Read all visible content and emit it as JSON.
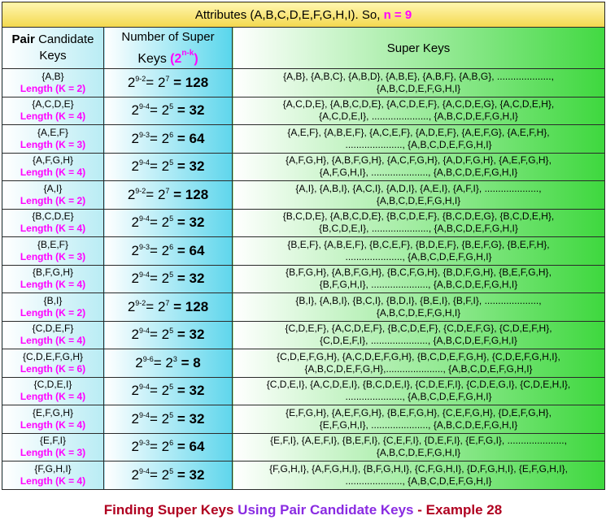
{
  "title": {
    "prefix": "Attributes (A,B,C,D,E,F,G,H,I). So,",
    "n_text": "n = 9"
  },
  "headers": {
    "col1_bold": "Pair",
    "col1_rest": "Candidate Keys",
    "col2_line1": "Number of Super",
    "col2_keys": "Keys",
    "col2_formula_base": "(2",
    "col2_formula_exp": "n-k",
    "col2_formula_close": ")",
    "col3": "Super Keys"
  },
  "rows": [
    {
      "key": "{A,B}",
      "length": "Length (K = 2)",
      "exp1": "9-2",
      "exp2": "7",
      "result": "= 128",
      "supers_line1": "{A,B}, {A,B,C}, {A,B,D}, {A,B,E}, {A,B,F}, {A,B,G}, ....................,",
      "supers_line2": "{A,B,C,D,E,F,G,H,I}"
    },
    {
      "key": "{A,C,D,E}",
      "length": "Length (K = 4)",
      "exp1": "9-4",
      "exp2": "5",
      "result": "= 32",
      "supers_line1": "{A,C,D,E}, {A,B,C,D,E}, {A,C,D,E,F}, {A,C,D,E,G}, {A,C,D,E,H},",
      "supers_line2": "{A,C,D,E,I}, ....................., {A,B,C,D,E,F,G,H,I}"
    },
    {
      "key": "{A,E,F}",
      "length": "Length (K = 3)",
      "exp1": "9-3",
      "exp2": "6",
      "result": "= 64",
      "supers_line1": "{A,E,F}, {A,B,E,F}, {A,C,E,F}, {A,D,E,F}, {A,E,F,G}, {A,E,F,H},",
      "supers_line2": "....................., {A,B,C,D,E,F,G,H,I}"
    },
    {
      "key": "{A,F,G,H}",
      "length": "Length (K = 4)",
      "exp1": "9-4",
      "exp2": "5",
      "result": "= 32",
      "supers_line1": "{A,F,G,H}, {A,B,F,G,H}, {A,C,F,G,H}, {A,D,F,G,H}, {A,E,F,G,H},",
      "supers_line2": "{A,F,G,H,I}, ....................., {A,B,C,D,E,F,G,H,I}"
    },
    {
      "key": "{A,I}",
      "length": "Length (K = 2)",
      "exp1": "9-2",
      "exp2": "7",
      "result": "= 128",
      "supers_line1": "{A,I}, {A,B,I}, {A,C,I}, {A,D,I}, {A,E,I}, {A,F,I}, ....................,",
      "supers_line2": "{A,B,C,D,E,F,G,H,I}"
    },
    {
      "key": "{B,C,D,E}",
      "length": "Length (K = 4)",
      "exp1": "9-4",
      "exp2": "5",
      "result": "= 32",
      "supers_line1": "{B,C,D,E}, {A,B,C,D,E}, {B,C,D,E,F}, {B,C,D,E,G}, {B,C,D,E,H},",
      "supers_line2": "{B,C,D,E,I}, ....................., {A,B,C,D,E,F,G,H,I}"
    },
    {
      "key": "{B,E,F}",
      "length": "Length (K = 3)",
      "exp1": "9-3",
      "exp2": "6",
      "result": "= 64",
      "supers_line1": "{B,E,F}, {A,B,E,F}, {B,C,E,F}, {B,D,E,F}, {B,E,F,G}, {B,E,F,H},",
      "supers_line2": "....................., {A,B,C,D,E,F,G,H,I}"
    },
    {
      "key": "{B,F,G,H}",
      "length": "Length (K = 4)",
      "exp1": "9-4",
      "exp2": "5",
      "result": "= 32",
      "supers_line1": "{B,F,G,H}, {A,B,F,G,H}, {B,C,F,G,H}, {B,D,F,G,H}, {B,E,F,G,H},",
      "supers_line2": "{B,F,G,H,I}, ....................., {A,B,C,D,E,F,G,H,I}"
    },
    {
      "key": "{B,I}",
      "length": "Length (K = 2)",
      "exp1": "9-2",
      "exp2": "7",
      "result": "= 128",
      "supers_line1": "{B,I}, {A,B,I}, {B,C,I}, {B,D,I}, {B,E,I}, {B,F,I}, ....................,",
      "supers_line2": "{A,B,C,D,E,F,G,H,I}"
    },
    {
      "key": "{C,D,E,F}",
      "length": "Length (K = 4)",
      "exp1": "9-4",
      "exp2": "5",
      "result": "= 32",
      "supers_line1": "{C,D,E,F}, {A,C,D,E,F}, {B,C,D,E,F}, {C,D,E,F,G}, {C,D,E,F,H},",
      "supers_line2": "{C,D,E,F,I}, ....................., {A,B,C,D,E,F,G,H,I}"
    },
    {
      "key": "{C,D,E,F,G,H}",
      "length": "Length (K = 6)",
      "exp1": "9-6",
      "exp2": "3",
      "result": "= 8",
      "supers_line1": "{C,D,E,F,G,H}, {A,C,D,E,F,G,H}, {B,C,D,E,F,G,H}, {C,D,E,F,G,H,I},",
      "supers_line2": "{A,B,C,D,E,F,G,H},....................., {A,B,C,D,E,F,G,H,I}"
    },
    {
      "key": "{C,D,E,I}",
      "length": "Length (K = 4)",
      "exp1": "9-4",
      "exp2": "5",
      "result": "= 32",
      "supers_line1": "{C,D,E,I}, {A,C,D,E,I}, {B,C,D,E,I}, {C,D,E,F,I}, {C,D,E,G,I}, {C,D,E,H,I},",
      "supers_line2": "....................., {A,B,C,D,E,F,G,H,I}"
    },
    {
      "key": "{E,F,G,H}",
      "length": "Length (K = 4)",
      "exp1": "9-4",
      "exp2": "5",
      "result": "= 32",
      "supers_line1": "{E,F,G,H}, {A,E,F,G,H}, {B,E,F,G,H}, {C,E,F,G,H}, {D,E,F,G,H},",
      "supers_line2": "{E,F,G,H,I}, ....................., {A,B,C,D,E,F,G,H,I}"
    },
    {
      "key": "{E,F,I}",
      "length": "Length (K = 3)",
      "exp1": "9-3",
      "exp2": "6",
      "result": "= 64",
      "supers_line1": "{E,F,I}, {A,E,F,I}, {B,E,F,I}, {C,E,F,I}, {D,E,F,I}, {E,F,G,I}, .....................,",
      "supers_line2": "{A,B,C,D,E,F,G,H,I}"
    },
    {
      "key": "{F,G,H,I}",
      "length": "Length (K = 4)",
      "exp1": "9-4",
      "exp2": "5",
      "result": "= 32",
      "supers_line1": "{F,G,H,I}, {A,F,G,H,I}, {B,F,G,H,I}, {C,F,G,H,I}, {D,F,G,H,I}, {E,F,G,H,I},",
      "supers_line2": "....................., {A,B,C,D,E,F,G,H,I}"
    }
  ],
  "caption": {
    "part1": "Finding Super Keys",
    "part2": "Using Pair Candidate Keys",
    "part3": "- Example 28"
  },
  "colors": {
    "title_bg": "#f3d84e",
    "key_col": "#b9ecf4",
    "num_col": "#58d6ec",
    "super_col": "#42d942",
    "magenta": "#ff00ff",
    "caption_red": "#b00020",
    "caption_purple": "#8a2be2"
  }
}
